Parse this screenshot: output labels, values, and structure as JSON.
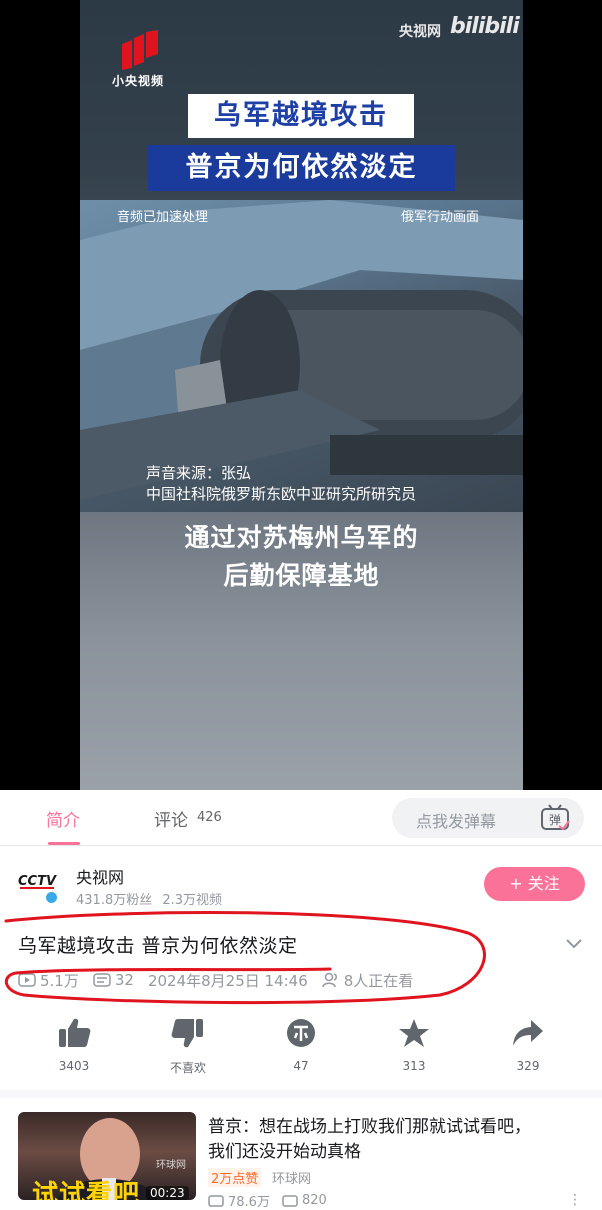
{
  "video": {
    "logo_text": "小央视频",
    "watermark_source": "央视网",
    "watermark_brand": "bilibili",
    "headline_line1": "乌军越境攻击",
    "headline_line2": "普京为何依然淡定",
    "caption_left": "音频已加速处理",
    "caption_right": "俄军行动画面",
    "source_line1": "声音来源：张弘",
    "source_line2": "中国社科院俄罗斯东欧中亚研究所研究员",
    "subtitle_line1": "通过对苏梅州乌军的",
    "subtitle_line2": "后勤保障基地"
  },
  "tabs": {
    "intro_label": "简介",
    "comments_label": "评论",
    "comments_count": "426",
    "danmaku_placeholder": "点我发弹幕",
    "danmaku_icon_text": "弹"
  },
  "uploader": {
    "avatar_text": "CCTV",
    "name": "央视网",
    "fans": "431.8万粉丝",
    "videos": "2.3万视频",
    "follow_label": "+ 关注"
  },
  "info": {
    "title": "乌军越境攻击 普京为何依然淡定",
    "views": "5.1万",
    "danmaku_count": "32",
    "date": "2024年8月25日 14:46",
    "watching": "8人正在看"
  },
  "actions": [
    {
      "name": "like",
      "label": "3403",
      "icon": "thumb-up-icon"
    },
    {
      "name": "dislike",
      "label": "不喜欢",
      "icon": "thumb-down-icon"
    },
    {
      "name": "coin",
      "label": "47",
      "icon": "coin-icon"
    },
    {
      "name": "favorite",
      "label": "313",
      "icon": "star-icon"
    },
    {
      "name": "share",
      "label": "329",
      "icon": "share-icon"
    }
  ],
  "recommendation": {
    "title_line1": "普京：想在战场上打败我们那就试试看吧，",
    "title_line2": "我们还没开始动真格",
    "badge": "2万点赞",
    "author": "环球网",
    "thumb_text": "试试看吧",
    "thumb_watermark": "环球网",
    "duration": "00:23",
    "views": "78.6万",
    "danmaku": "820"
  },
  "colors": {
    "accent": "#fb7299",
    "headline_blue": "#1b3b9c",
    "annotation_red": "#e0141e"
  }
}
